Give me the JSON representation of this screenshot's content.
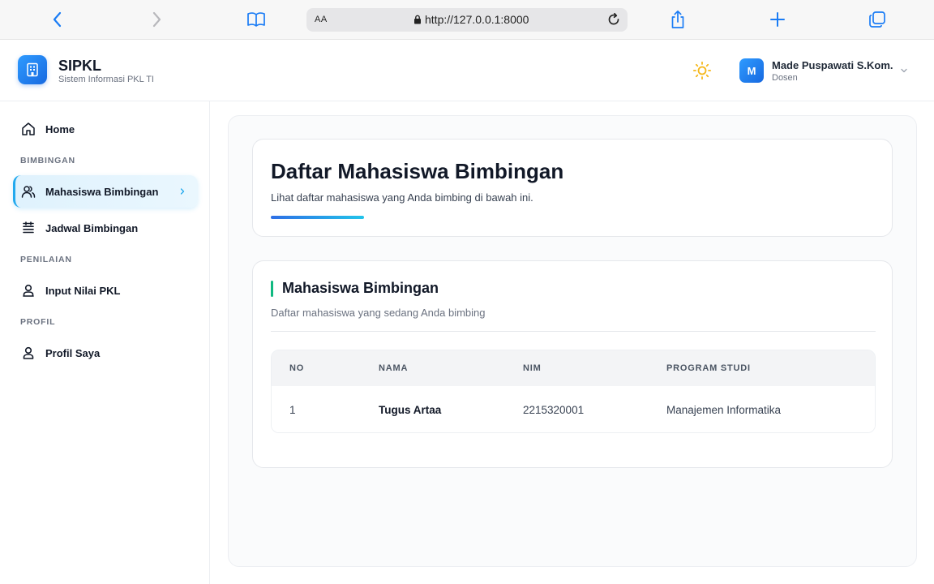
{
  "browser": {
    "url_aa": "AA",
    "url": "http://127.0.0.1:8000"
  },
  "app": {
    "title": "SIPKL",
    "subtitle": "Sistem Informasi PKL TI"
  },
  "user": {
    "initial": "M",
    "name": "Made Puspawati S.Kom.",
    "role": "Dosen"
  },
  "sidebar": {
    "home": "Home",
    "sections": {
      "bimbingan": "BIMBINGAN",
      "penilaian": "PENILAIAN",
      "profil": "PROFIL"
    },
    "items": {
      "mahasiswa_bimbingan": "Mahasiswa Bimbingan",
      "jadwal_bimbingan": "Jadwal Bimbingan",
      "input_nilai": "Input Nilai PKL",
      "profil_saya": "Profil Saya"
    }
  },
  "hero": {
    "title": "Daftar Mahasiswa Bimbingan",
    "subtitle": "Lihat daftar mahasiswa yang Anda bimbing di bawah ini."
  },
  "list": {
    "title": "Mahasiswa Bimbingan",
    "subtitle": "Daftar mahasiswa yang sedang Anda bimbing",
    "columns": [
      "NO",
      "NAMA",
      "NIM",
      "PROGRAM STUDI"
    ],
    "rows": [
      {
        "no": "1",
        "nama": "Tugus Artaa",
        "nim": "2215320001",
        "prodi": "Manajemen Informatika"
      }
    ]
  },
  "colors": {
    "accent_blue": "#1769e0",
    "active_bg": "#dff2fd",
    "active_border": "#22a9ee",
    "title_accent_green": "#10b981",
    "sun_icon": "#f5b81c"
  }
}
